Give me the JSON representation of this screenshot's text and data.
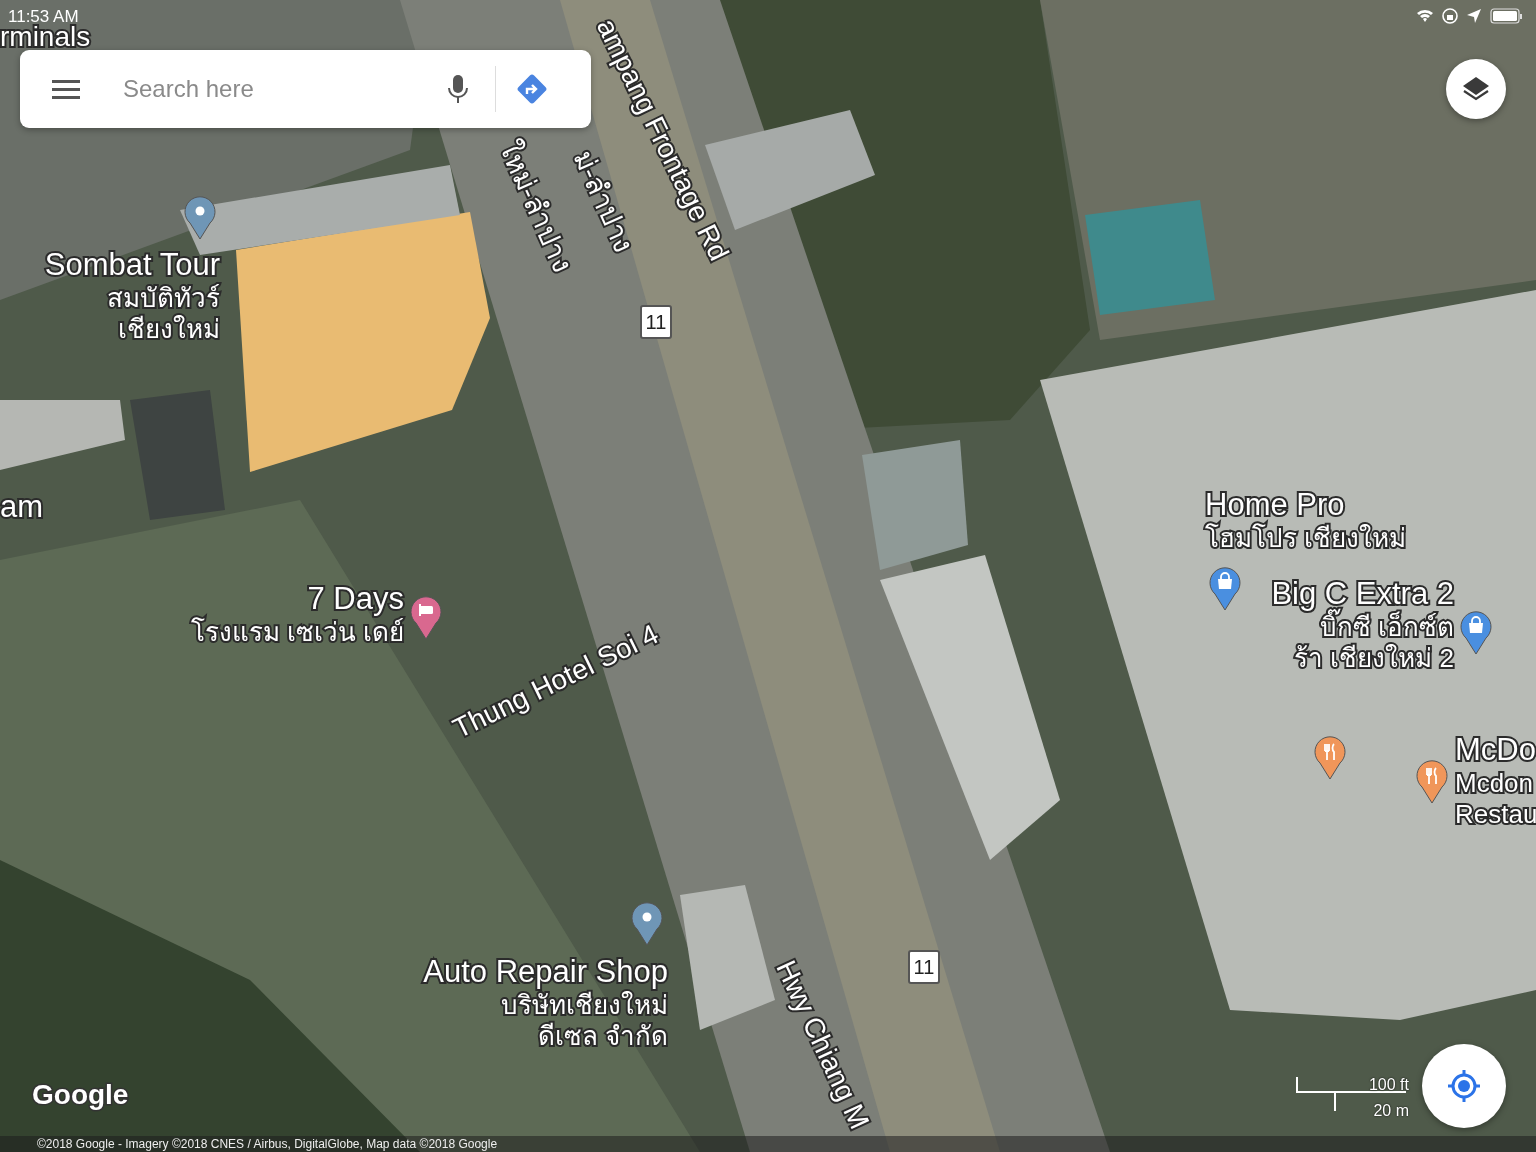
{
  "status_bar": {
    "time": "11:53 AM"
  },
  "search": {
    "placeholder": "Search here"
  },
  "labels": [
    {
      "kind": "poi",
      "title": "rminals"
    },
    {
      "kind": "poi",
      "title": "Sombat Tour",
      "lines": [
        "สมบัติทัวร์",
        "เชียงใหม่"
      ]
    },
    {
      "kind": "poi",
      "title": "am"
    },
    {
      "kind": "poi",
      "title": "7 Days",
      "lines": [
        "โรงแรม เซเว่น เดย์"
      ]
    },
    {
      "kind": "poi",
      "title": "Auto Repair Shop",
      "lines": [
        "บริษัทเชียงใหม่",
        "ดีเซล จำกัด"
      ]
    },
    {
      "kind": "poi",
      "title": "Home Pro",
      "lines": [
        "โฮมโปร เชียงใหม่"
      ]
    },
    {
      "kind": "poi",
      "title": "Big C Extra 2",
      "lines": [
        "บิ๊กซี เอ็กซ์ต",
        "ร้า เชียงใหม่ 2"
      ]
    },
    {
      "kind": "poi",
      "title": "McDo",
      "lines": [
        "Mcdon",
        "Restau"
      ]
    },
    {
      "kind": "road",
      "title": "ampang Frontage Rd"
    },
    {
      "kind": "road",
      "title": "ใหม่-ลำปาง"
    },
    {
      "kind": "road",
      "title": "ม่-ลำปาง"
    },
    {
      "kind": "road",
      "title": "Thung Hotel Soi 4"
    },
    {
      "kind": "road",
      "title": "Hwy Chiang M"
    },
    {
      "kind": "shield",
      "title": "11"
    },
    {
      "kind": "shield",
      "title": "11"
    }
  ],
  "pins": [
    {
      "kind": "place",
      "color": "#6f96b6"
    },
    {
      "kind": "place",
      "color": "#6f96b6"
    },
    {
      "kind": "hotel",
      "color": "#d9688f"
    },
    {
      "kind": "shopping",
      "color": "#4a8fe0"
    },
    {
      "kind": "shopping",
      "color": "#4a8fe0"
    },
    {
      "kind": "restaurant",
      "color": "#f0965a"
    },
    {
      "kind": "restaurant",
      "color": "#f0965a"
    }
  ],
  "scale": {
    "imperial": "100 ft",
    "metric": "20 m"
  },
  "logo": "Google",
  "attribution": "©2018 Google - Imagery ©2018 CNES / Airbus, DigitalGlobe, Map data ©2018 Google"
}
